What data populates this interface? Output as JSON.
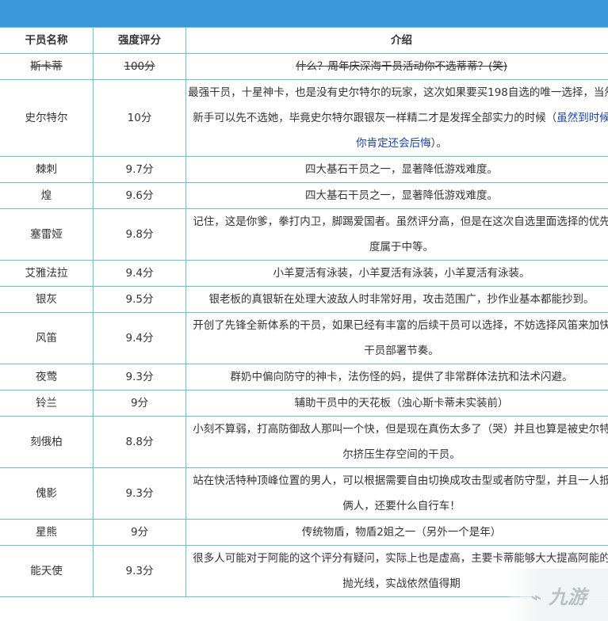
{
  "headers": [
    "干员名称",
    "强度评分",
    "介绍"
  ],
  "rows": [
    {
      "name": "斯卡蒂",
      "score": "100分",
      "intro": "什么？周年庆深海干员活动你不选蒂蒂？(笑)",
      "strike": true
    },
    {
      "name": "史尔特尔",
      "score": "10分",
      "intro": "最强干员，十星神卡，也是没有史尔特尔的玩家，这次如果要买198自选的唯一选择，当然新手可以先不选她，毕竟史尔特尔跟银灰一样精二才是发挥全部实力的时候（",
      "intro_highlight": "虽然到时候你肯定还会后悔",
      "intro_tail": "）。"
    },
    {
      "name": "棘刺",
      "score": "9.7分",
      "intro": "四大基石干员之一，显著降低游戏难度。"
    },
    {
      "name": "煌",
      "score": "9.6分",
      "intro": "四大基石干员之一，显著降低游戏难度。"
    },
    {
      "name": "塞雷娅",
      "score": "9.8分",
      "intro": "记住，这是你爹，拳打内卫，脚踢爱国者。虽然评分高，但是在这次自选里面选择的优先度属于中等。"
    },
    {
      "name": "艾雅法拉",
      "score": "9.4分",
      "intro": "小羊夏活有泳装，小羊夏活有泳装，小羊夏活有泳装。"
    },
    {
      "name": "银灰",
      "score": "9.5分",
      "intro": "银老板的真银斩在处理大波敌人时非常好用，攻击范围广，抄作业基本都能抄到。"
    },
    {
      "name": "风笛",
      "score": "9.4分",
      "intro": "开创了先锋全新体系的干员，如果已经有丰富的后续干员可以选择，不妨选择风笛来加快干员部署节奏。"
    },
    {
      "name": "夜莺",
      "score": "9.3分",
      "intro": "群奶中偏向防守的神卡，法伤怪的妈，提供了非常群体法抗和法术闪避。"
    },
    {
      "name": "铃兰",
      "score": "9分",
      "intro": "辅助干员中的天花板（浊心斯卡蒂未实装前）"
    },
    {
      "name": "刻俄柏",
      "score": "8.8分",
      "intro": "小刻不算弱，打高防御敌人那叫一个快，但是现在真伤太多了（哭）并且也算是被史尔特尔挤压生存空间的干员。"
    },
    {
      "name": "傀影",
      "score": "9.3分",
      "intro": "站在快活特种顶峰位置的男人，可以根据需要自由切换成攻击型或者防守型，并且一人抵俩人，还要什么自行车！"
    },
    {
      "name": "星熊",
      "score": "9分",
      "intro": "传统物盾，物盾2姐之一（另外一个是年）"
    },
    {
      "name": "能天使",
      "score": "9.3分",
      "intro": "很多人可能对于阿能的这个评分有疑问，实际上也是虚高，主要卡蒂能够大大提高阿能的抛光线，实战依然值得期"
    }
  ],
  "watermark": "九游",
  "colors": {
    "banner": "#3a9ad9",
    "border": "#63c6d6",
    "highlight": "#1a3fb0"
  }
}
